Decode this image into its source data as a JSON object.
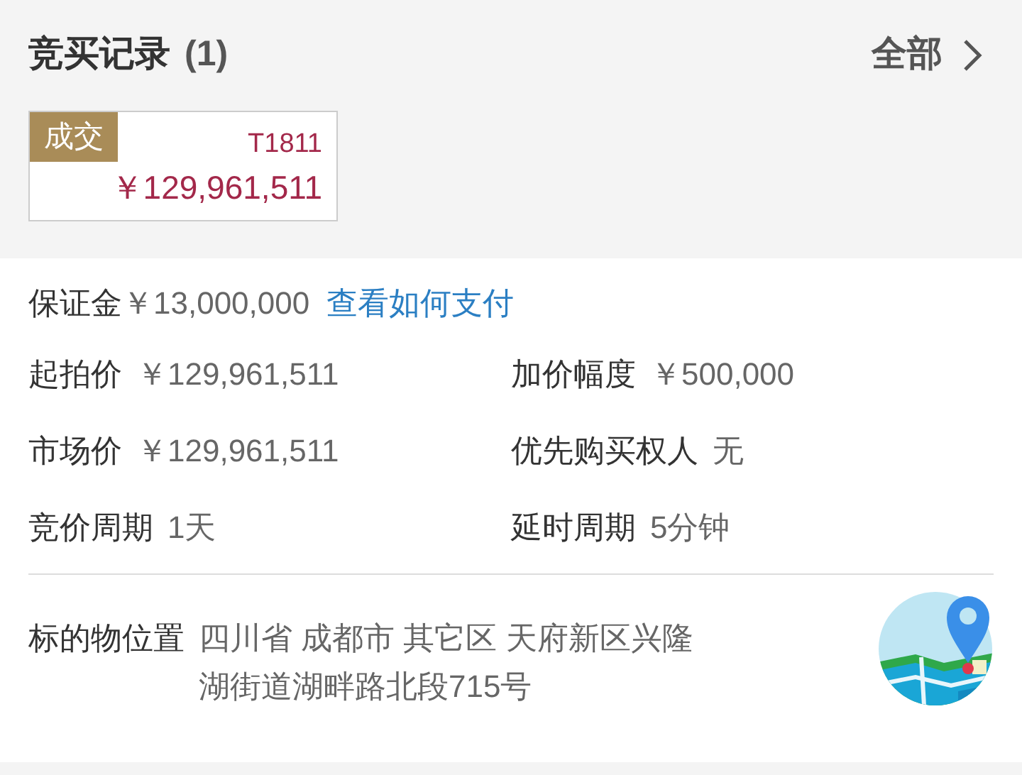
{
  "bid_records": {
    "title": "竞买记录",
    "count": "(1)",
    "all_link": "全部",
    "records": [
      {
        "status": "成交",
        "code": "T1811",
        "price": "￥129,961,511"
      }
    ]
  },
  "deposit": {
    "label": "保证金",
    "value": "￥13,000,000",
    "link": "查看如何支付"
  },
  "details": [
    {
      "label": "起拍价",
      "value": "￥129,961,511"
    },
    {
      "label": "加价幅度",
      "value": "￥500,000"
    },
    {
      "label": "市场价",
      "value": "￥129,961,511"
    },
    {
      "label": "优先购买权人",
      "value": "无"
    },
    {
      "label": "竞价周期",
      "value": "1天"
    },
    {
      "label": "延时周期",
      "value": "5分钟"
    }
  ],
  "location": {
    "label": "标的物位置",
    "lines": [
      "四川省 成都市 其它区 天府新区兴隆",
      "湖街道湖畔路北段715号"
    ]
  }
}
